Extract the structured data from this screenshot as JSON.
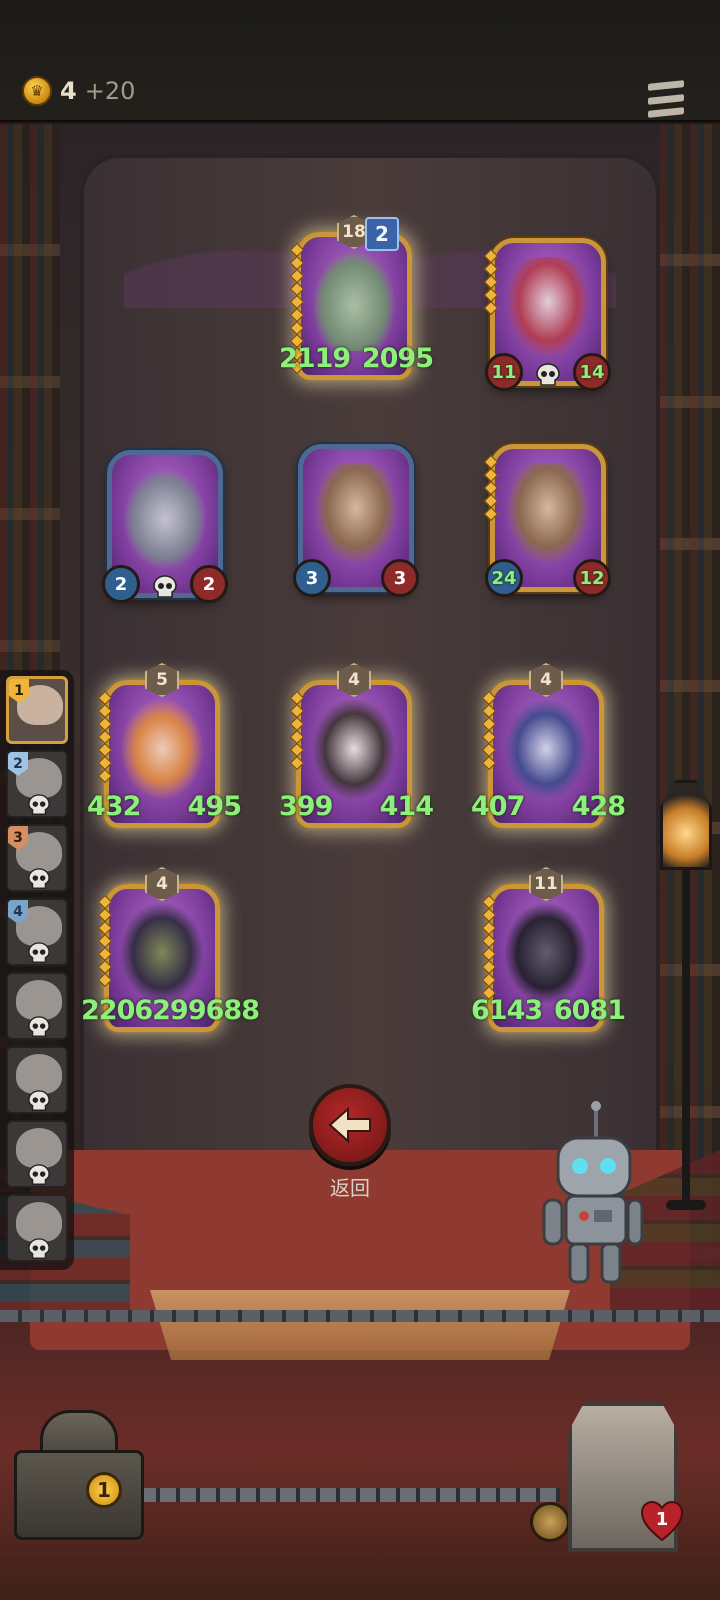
{
  "header": {
    "gold": "4",
    "gold_income": "+20"
  },
  "colors": {
    "gold": "#f0b43a",
    "card_border_gold": "#c9973a",
    "card_border_blue": "#4e6a92",
    "attack": "#2f5f8f",
    "health": "#8e2a2a",
    "buffed_stat": "#8df07a",
    "back_button": "#b32828"
  },
  "icons": {
    "coin": "crown-coin-icon",
    "menu": "hamburger-menu-icon",
    "back": "arrow-left-icon",
    "death": "skull-icon",
    "bell": "bell-icon"
  },
  "board": {
    "cards": [
      {
        "name": "goat-sorcerer",
        "tier": "18",
        "hourglass": "2",
        "attack": "2119",
        "health": "2095",
        "golden": true
      },
      {
        "name": "clown-jester",
        "attack": "11",
        "health": "14",
        "golden": true
      },
      {
        "name": "tin-robot",
        "attack": "2",
        "health": "2",
        "golden": false
      },
      {
        "name": "rocket-ship",
        "attack": "3",
        "health": "3",
        "golden": false
      },
      {
        "name": "rocket-ship-gold",
        "attack": "24",
        "health": "12",
        "golden": true
      },
      {
        "name": "goggles-mechanic",
        "tier": "5",
        "attack": "432",
        "health": "495",
        "golden": true
      },
      {
        "name": "cow-dog",
        "tier": "4",
        "attack": "399",
        "health": "414",
        "golden": true
      },
      {
        "name": "witch-girl",
        "tier": "4",
        "attack": "407",
        "health": "428",
        "golden": true
      },
      {
        "name": "shadow-fiend",
        "tier": "4",
        "attack": "220629",
        "health": "9688",
        "golden": true
      },
      {
        "name": "dark-knight",
        "tier": "11",
        "attack": "6143",
        "health": "6081",
        "golden": true
      }
    ]
  },
  "back_label": "返回",
  "roster": {
    "ranks": [
      "1",
      "2",
      "3",
      "4"
    ]
  },
  "hud": {
    "chest_count": "1",
    "lives": "1"
  }
}
